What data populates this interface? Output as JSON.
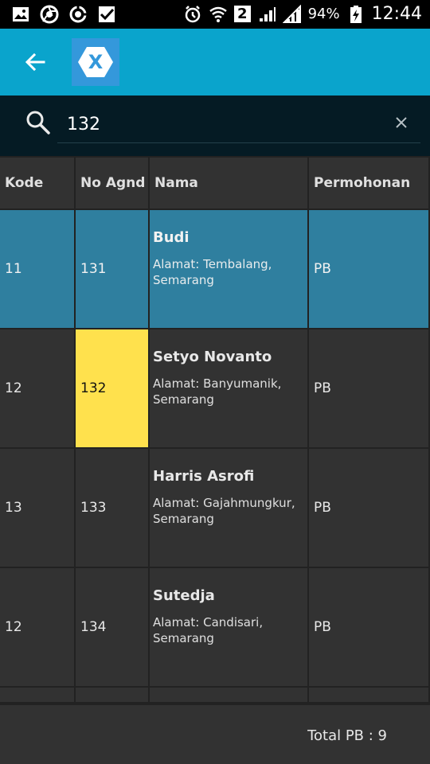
{
  "status_bar": {
    "battery_text": "94%",
    "time": "12:44",
    "sim_badge": "2",
    "icons": [
      "gallery-icon",
      "chrome-icon",
      "sync-icon",
      "check-icon",
      "alarm-icon",
      "wifi-icon",
      "signal-icon",
      "battery-icon"
    ]
  },
  "app_bar": {
    "back_icon": "arrow-left-icon",
    "logo": "xamarin-logo",
    "logo_letter": "X"
  },
  "search": {
    "value": "132",
    "clear_icon": "close-icon"
  },
  "table": {
    "headers": [
      "Kode",
      "No Agnd",
      "Nama",
      "Permohonan"
    ],
    "rows": [
      {
        "kode": "11",
        "no_agnd": "131",
        "nama": "Budi",
        "alamat": "Alamat: Tembalang, Semarang",
        "permohonan": "PB",
        "state": "selected"
      },
      {
        "kode": "12",
        "no_agnd": "132",
        "nama": "Setyo Novanto",
        "alamat": "Alamat: Banyumanik, Semarang",
        "permohonan": "PB",
        "state": "search-match"
      },
      {
        "kode": "13",
        "no_agnd": "133",
        "nama": "Harris Asrofi",
        "alamat": "Alamat: Gajahmungkur, Semarang",
        "permohonan": "PB",
        "state": "normal"
      },
      {
        "kode": "12",
        "no_agnd": "134",
        "nama": "Sutedja",
        "alamat": "Alamat: Candisari, Semarang",
        "permohonan": "PB",
        "state": "normal"
      }
    ]
  },
  "footer": {
    "total": "Total PB : 9"
  },
  "colors": {
    "app_bar": "#0aa4cc",
    "search_bar": "#051b24",
    "table_background": "#323232",
    "selected_row": "#2f7f9f",
    "match_highlight": "#ffe14d",
    "logo_background": "#3498db"
  }
}
